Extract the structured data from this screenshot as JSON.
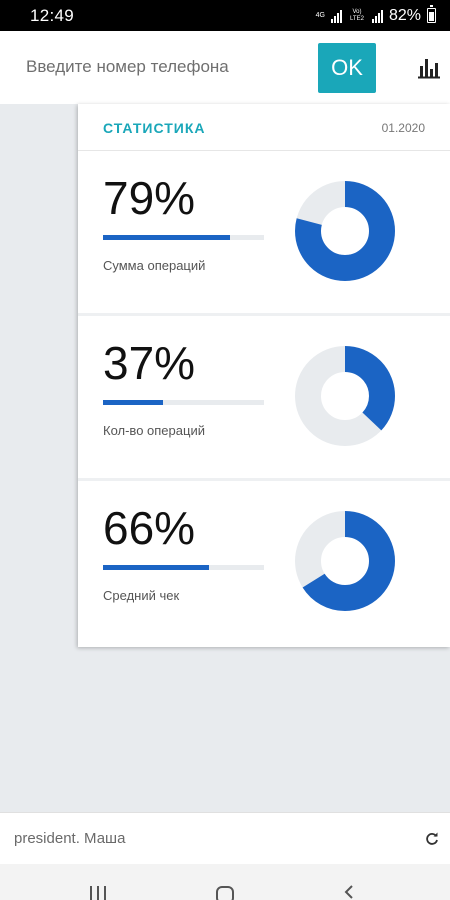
{
  "status_bar": {
    "time": "12:49",
    "network_top": "4G",
    "network_label": "Vo) LTE2",
    "battery": "82%"
  },
  "header": {
    "phone_placeholder": "Введите номер телефона",
    "phone_value": "",
    "ok_label": "OK",
    "stats_icon": "bar-chart-icon"
  },
  "stats": {
    "title": "СТАТИСТИКА",
    "date": "01.2020",
    "cards": [
      {
        "value": "79%",
        "percent": 79,
        "label": "Сумма операций"
      },
      {
        "value": "37%",
        "percent": 37,
        "label": "Кол-во операций"
      },
      {
        "value": "66%",
        "percent": 66,
        "label": "Средний чек"
      }
    ]
  },
  "footer": {
    "user": "president. Маша",
    "refresh_icon": "refresh-icon"
  },
  "nav": {
    "recents_icon": "recents-icon",
    "home_icon": "home-icon",
    "back_icon": "back-icon"
  },
  "colors": {
    "accent": "#1aa7b9",
    "progress": "#1b64c4",
    "track": "#e8ebee"
  }
}
